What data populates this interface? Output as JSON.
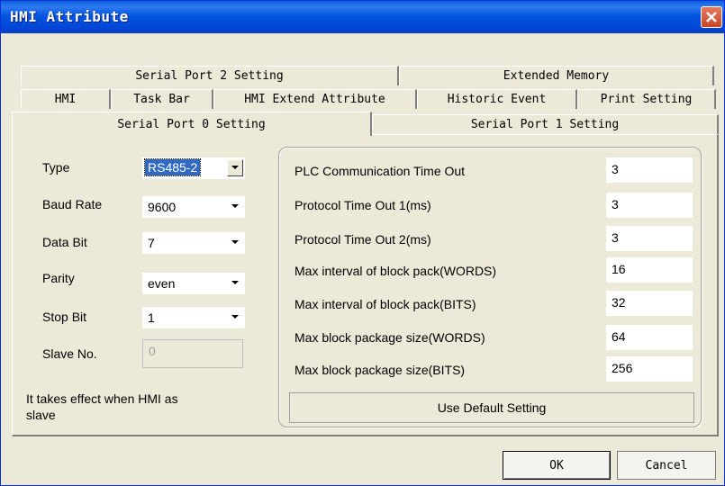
{
  "window": {
    "title": "HMI Attribute"
  },
  "tabs": {
    "row1": [
      "Serial Port 2 Setting",
      "Extended Memory"
    ],
    "row2": [
      "HMI",
      "Task Bar",
      "HMI Extend Attribute",
      "Historic Event",
      "Print Setting"
    ],
    "row3": [
      "Serial Port 0 Setting",
      "Serial Port 1 Setting"
    ],
    "active": "Serial Port 0 Setting"
  },
  "port_settings": {
    "type_label": "Type",
    "type_value": "RS485-2",
    "baud_label": "Baud Rate",
    "baud_value": "9600",
    "databit_label": "Data Bit",
    "databit_value": "7",
    "parity_label": "Parity",
    "parity_value": "even",
    "stopbit_label": "Stop Bit",
    "stopbit_value": "1",
    "slave_label": "Slave No.",
    "slave_value": "0",
    "note_line1": "It takes effect when HMI as",
    "note_line2": "slave"
  },
  "parameters": [
    {
      "label": "PLC Communication Time Out",
      "value": "3"
    },
    {
      "label": "Protocol Time Out 1(ms)",
      "value": "3"
    },
    {
      "label": "Protocol Time Out 2(ms)",
      "value": "3"
    },
    {
      "label": "Max interval of block pack(WORDS)",
      "value": "16"
    },
    {
      "label": "Max interval of block pack(BITS)",
      "value": "32"
    },
    {
      "label": "Max block package size(WORDS)",
      "value": "64"
    },
    {
      "label": "Max block package size(BITS)",
      "value": "256"
    }
  ],
  "buttons": {
    "default_label": "Use Default Setting",
    "ok_label": "OK",
    "cancel_label": "Cancel"
  },
  "colors": {
    "title_bar": "#0555e0",
    "dialog_bg": "#ece9d8",
    "selection": "#316ac5",
    "close_button": "#c8452a"
  }
}
